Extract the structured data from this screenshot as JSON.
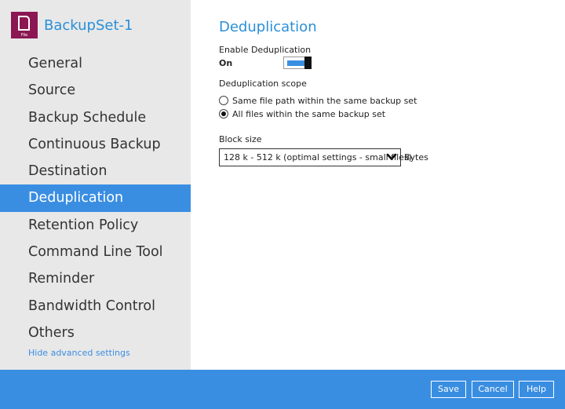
{
  "app": {
    "title": "BackupSet-1",
    "icon_name": "file-icon",
    "icon_label": "File",
    "icon_color": "#8b1852"
  },
  "sidebar": {
    "items": [
      {
        "label": "General"
      },
      {
        "label": "Source"
      },
      {
        "label": "Backup Schedule"
      },
      {
        "label": "Continuous Backup"
      },
      {
        "label": "Destination"
      },
      {
        "label": "Deduplication",
        "active": true
      },
      {
        "label": "Retention Policy"
      },
      {
        "label": "Command Line Tool"
      },
      {
        "label": "Reminder"
      },
      {
        "label": "Bandwidth Control"
      },
      {
        "label": "Others"
      }
    ],
    "hide_link": "Hide advanced settings"
  },
  "main": {
    "title": "Deduplication",
    "enable_label": "Enable Deduplication",
    "toggle_state": "On",
    "scope_label": "Deduplication scope",
    "scope_options": [
      {
        "label": "Same file path within the same backup set",
        "checked": false
      },
      {
        "label": "All files within the same backup set",
        "checked": true
      }
    ],
    "block_size_label": "Block size",
    "block_size_value": "128 k - 512 k (optimal settings - small files)",
    "block_size_unit": "Bytes"
  },
  "footer": {
    "save_label": "Save",
    "cancel_label": "Cancel",
    "help_label": "Help"
  },
  "colors": {
    "accent": "#3a8ee2",
    "title": "#2a8fd8",
    "sidebar_bg": "#e8e8e8"
  }
}
